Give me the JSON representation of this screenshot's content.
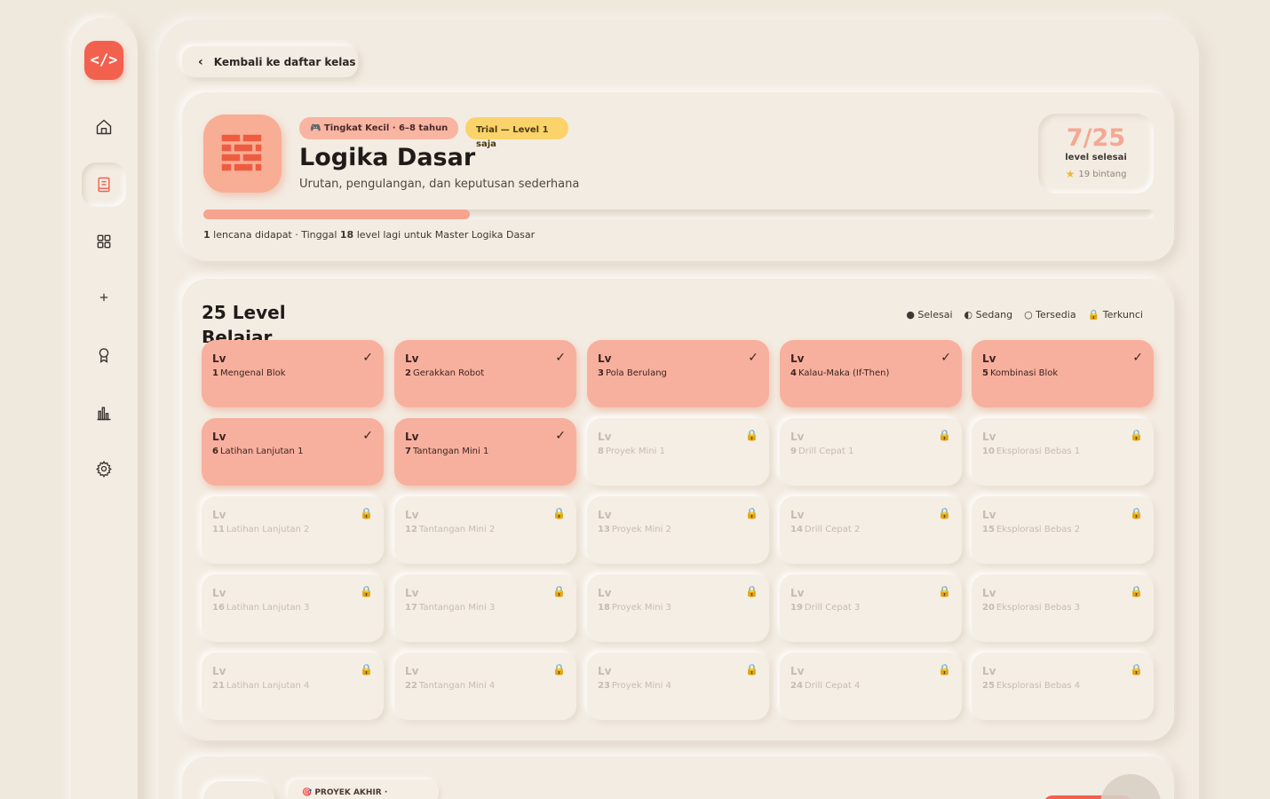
{
  "sidebar": {
    "logo_text": "</>",
    "items": [
      {
        "name": "home",
        "icon": "home-icon"
      },
      {
        "name": "classes",
        "icon": "book-icon",
        "active": true
      },
      {
        "name": "dashboard",
        "icon": "grid-icon"
      },
      {
        "name": "add",
        "icon": "plus-icon"
      },
      {
        "name": "achievements",
        "icon": "medal-icon"
      },
      {
        "name": "stats",
        "icon": "bar-chart-icon"
      },
      {
        "name": "settings",
        "icon": "gear-icon"
      }
    ]
  },
  "back_button": {
    "label": "Kembali ke daftar kelas"
  },
  "course": {
    "level_badge": "🎮 Tingkat Kecil · 6–8 tahun",
    "trial_badge": "Trial — Level 1 saja",
    "title": "Logika Dasar",
    "subtitle": "Urutan, pengulangan, dan keputusan sederhana",
    "progress_fraction": 0.28,
    "footnote_badges": "1",
    "footnote_mid": " lencana didapat · Tinggal ",
    "footnote_remaining": "18",
    "footnote_end": " level lagi untuk Master Logika Dasar",
    "stat_value": "7/25",
    "stat_label": "level selesai",
    "stars_label": "19 bintang"
  },
  "levels": {
    "title": "25 Level Belajar",
    "legend": {
      "done": "● Selesai",
      "in_progress": "◐ Sedang",
      "available": "○ Tersedia",
      "locked": "🔒 Terkunci"
    },
    "tag": "Lv",
    "items": [
      {
        "num": "1",
        "name": "Mengenal Blok",
        "status": "done",
        "mark": "✓"
      },
      {
        "num": "2",
        "name": "Gerakkan Robot",
        "status": "done",
        "mark": "✓"
      },
      {
        "num": "3",
        "name": "Pola Berulang",
        "status": "done",
        "mark": "✓"
      },
      {
        "num": "4",
        "name": "Kalau-Maka (If-Then)",
        "status": "done",
        "mark": "✓"
      },
      {
        "num": "5",
        "name": "Kombinasi Blok",
        "status": "done",
        "mark": "✓"
      },
      {
        "num": "6",
        "name": "Latihan Lanjutan 1",
        "status": "done",
        "mark": "✓"
      },
      {
        "num": "7",
        "name": "Tantangan Mini 1",
        "status": "done",
        "mark": "✓"
      },
      {
        "num": "8",
        "name": "Proyek Mini 1",
        "status": "locked",
        "mark": "🔒"
      },
      {
        "num": "9",
        "name": "Drill Cepat 1",
        "status": "locked",
        "mark": "🔒"
      },
      {
        "num": "10",
        "name": "Eksplorasi Bebas 1",
        "status": "locked",
        "mark": "🔒"
      },
      {
        "num": "11",
        "name": "Latihan Lanjutan 2",
        "status": "locked",
        "mark": "🔒"
      },
      {
        "num": "12",
        "name": "Tantangan Mini 2",
        "status": "locked",
        "mark": "🔒"
      },
      {
        "num": "13",
        "name": "Proyek Mini 2",
        "status": "locked",
        "mark": "🔒"
      },
      {
        "num": "14",
        "name": "Drill Cepat 2",
        "status": "locked",
        "mark": "🔒"
      },
      {
        "num": "15",
        "name": "Eksplorasi Bebas 2",
        "status": "locked",
        "mark": "🔒"
      },
      {
        "num": "16",
        "name": "Latihan Lanjutan 3",
        "status": "locked",
        "mark": "🔒"
      },
      {
        "num": "17",
        "name": "Tantangan Mini 3",
        "status": "locked",
        "mark": "🔒"
      },
      {
        "num": "18",
        "name": "Proyek Mini 3",
        "status": "locked",
        "mark": "🔒"
      },
      {
        "num": "19",
        "name": "Drill Cepat 3",
        "status": "locked",
        "mark": "🔒"
      },
      {
        "num": "20",
        "name": "Eksplorasi Bebas 3",
        "status": "locked",
        "mark": "🔒"
      },
      {
        "num": "21",
        "name": "Latihan Lanjutan 4",
        "status": "locked",
        "mark": "🔒"
      },
      {
        "num": "22",
        "name": "Tantangan Mini 4",
        "status": "locked",
        "mark": "🔒"
      },
      {
        "num": "23",
        "name": "Proyek Mini 4",
        "status": "locked",
        "mark": "🔒"
      },
      {
        "num": "24",
        "name": "Drill Cepat 4",
        "status": "locked",
        "mark": "🔒"
      },
      {
        "num": "25",
        "name": "Eksplorasi Bebas 4",
        "status": "locked",
        "mark": "🔒"
      }
    ]
  },
  "final_project": {
    "tag": "🎯 PROYEK AKHIR ·"
  },
  "colors": {
    "accent": "#f2604e",
    "done_tile": "#f8b09e",
    "progress": "#f6a38f",
    "trial": "#fbd36b",
    "background": "#efe8dd"
  }
}
